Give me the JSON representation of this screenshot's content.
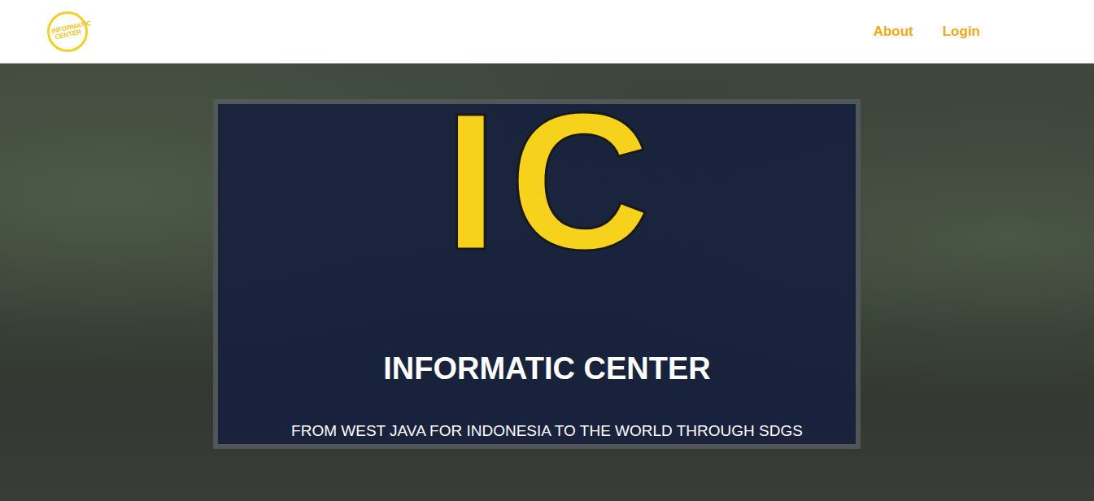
{
  "header": {
    "logo": {
      "text": "INFORMATIC CENTER"
    },
    "nav": [
      {
        "label": "About"
      },
      {
        "label": "Login"
      }
    ]
  },
  "hero": {
    "logo_text": "IC",
    "title": "INFORMATIC CENTER",
    "subtitle": "FROM WEST JAVA FOR INDONESIA TO THE WORLD THROUGH SDGS"
  }
}
